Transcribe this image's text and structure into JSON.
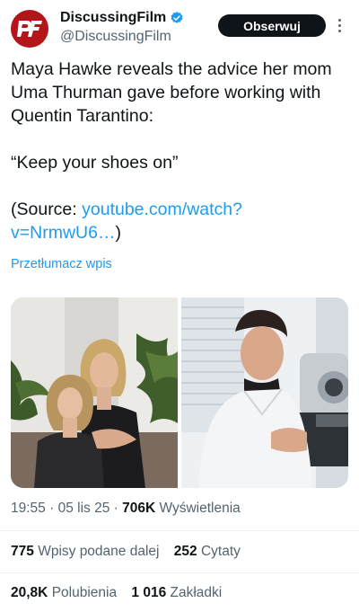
{
  "author": {
    "display_name": "DiscussingFilm",
    "handle": "@DiscussingFilm",
    "avatar_text": "DF",
    "avatar_color": "#b3151b",
    "verified_color": "#1d9bf0"
  },
  "follow_label": "Obserwuj",
  "tweet": {
    "line1": "Maya Hawke reveals the advice her mom Uma Thurman gave before working with Quentin Tarantino:",
    "quote": "“Keep your shoes on”",
    "source_prefix": "(Source: ",
    "source_link": "youtube.com/watch?v=NrmwU6…",
    "source_suffix": ")"
  },
  "translate_label": "Przetłumacz wpis",
  "meta": {
    "time": "19:55",
    "date": "05 lis 25",
    "views_count": "706K",
    "views_label": "Wyświetlenia"
  },
  "stats": {
    "reposts_count": "775",
    "reposts_label": "Wpisy podane dalej",
    "quotes_count": "252",
    "quotes_label": "Cytaty",
    "likes_count": "20,8K",
    "likes_label": "Polubienia",
    "bookmarks_count": "1 016",
    "bookmarks_label": "Zakładki"
  },
  "colors": {
    "link": "#1d9bf0",
    "secondary_text": "#536471",
    "primary_text": "#0f1419"
  }
}
